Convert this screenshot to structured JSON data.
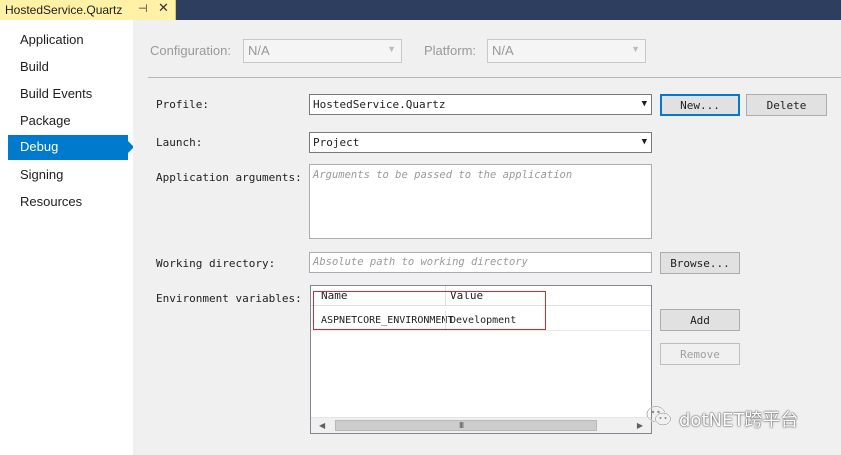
{
  "document_tab": {
    "title": "HostedService.Quartz",
    "pin_glyph": "⊣",
    "close_glyph": "✕"
  },
  "sidebar": {
    "items": [
      {
        "label": "Application"
      },
      {
        "label": "Build"
      },
      {
        "label": "Build Events"
      },
      {
        "label": "Package"
      },
      {
        "label": "Debug",
        "active": true
      },
      {
        "label": "Signing"
      },
      {
        "label": "Resources"
      }
    ]
  },
  "config_bar": {
    "configuration_label": "Configuration:",
    "configuration_value": "N/A",
    "platform_label": "Platform:",
    "platform_value": "N/A"
  },
  "profile": {
    "label": "Profile:",
    "value": "HostedService.Quartz",
    "new_button": "New...",
    "delete_button": "Delete"
  },
  "launch": {
    "label": "Launch:",
    "value": "Project"
  },
  "app_args": {
    "label": "Application arguments:",
    "placeholder": "Arguments to be passed to the application"
  },
  "working_dir": {
    "label": "Working directory:",
    "placeholder": "Absolute path to working directory",
    "browse_button": "Browse..."
  },
  "env_vars": {
    "label": "Environment variables:",
    "columns": [
      "Name",
      "Value"
    ],
    "rows": [
      {
        "name": "ASPNETCORE_ENVIRONMENT",
        "value": "Development"
      }
    ],
    "add_button": "Add",
    "remove_button": "Remove",
    "scroll_grip": "III"
  },
  "watermark": {
    "text": "dotNET跨平台"
  },
  "colors": {
    "accent": "#007acc",
    "tab_bg": "#fff1a6",
    "titlebar": "#2d3e5e",
    "highlight": "#d42a2a"
  }
}
